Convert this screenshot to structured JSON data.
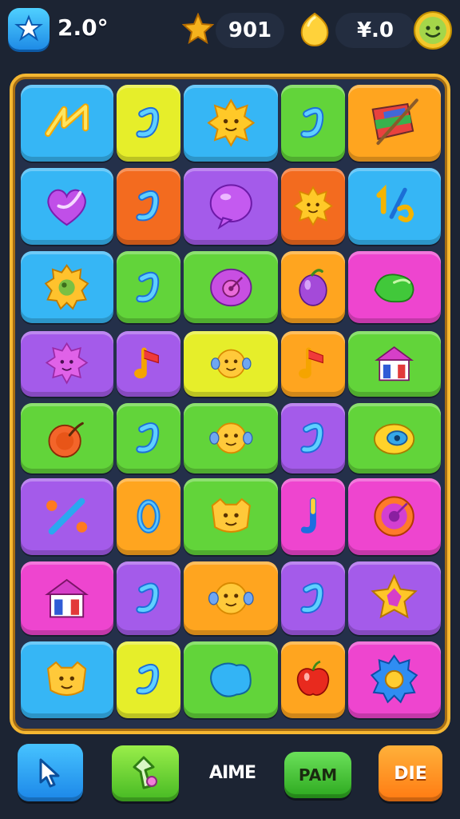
{
  "hud": {
    "level_value": "2.0°",
    "score_value": "901",
    "coins_value": "¥.0"
  },
  "bottom_bar": {
    "cursor_button": "cursor-icon",
    "hammer_button": "hammer-icon",
    "aime_label": "AIME",
    "pam_label": "PAM",
    "die_label": "DIE"
  },
  "board": {
    "rows": 8,
    "cols": 5,
    "colors": {
      "blue": "#36b6f5",
      "yellow": "#e6ee2a",
      "green": "#62d43a",
      "orange": "#ffa51f",
      "red": "#f36b1f",
      "purple": "#a45bea",
      "pink": "#ee45cf"
    },
    "tiles": [
      {
        "color": "blue",
        "icon": "zigzag"
      },
      {
        "color": "yellow",
        "icon": "swirl"
      },
      {
        "color": "blue",
        "icon": "sun-face"
      },
      {
        "color": "green",
        "icon": "swirl"
      },
      {
        "color": "orange",
        "icon": "flag"
      },
      {
        "color": "blue",
        "icon": "heart"
      },
      {
        "color": "red",
        "icon": "swirl"
      },
      {
        "color": "purple",
        "icon": "bubble"
      },
      {
        "color": "red",
        "icon": "sun-face"
      },
      {
        "color": "blue",
        "icon": "fraction"
      },
      {
        "color": "blue",
        "icon": "gear"
      },
      {
        "color": "green",
        "icon": "swirl"
      },
      {
        "color": "green",
        "icon": "heart-target"
      },
      {
        "color": "orange",
        "icon": "plum"
      },
      {
        "color": "pink",
        "icon": "leaf"
      },
      {
        "color": "purple",
        "icon": "spiky-face"
      },
      {
        "color": "purple",
        "icon": "music-note"
      },
      {
        "color": "yellow",
        "icon": "smiley-face"
      },
      {
        "color": "orange",
        "icon": "music-note"
      },
      {
        "color": "green",
        "icon": "house"
      },
      {
        "color": "green",
        "icon": "bomb"
      },
      {
        "color": "green",
        "icon": "swirl"
      },
      {
        "color": "green",
        "icon": "smiley-face"
      },
      {
        "color": "purple",
        "icon": "swirl"
      },
      {
        "color": "green",
        "icon": "eye"
      },
      {
        "color": "purple",
        "icon": "slash-flowers"
      },
      {
        "color": "orange",
        "icon": "ring"
      },
      {
        "color": "green",
        "icon": "cat-face"
      },
      {
        "color": "pink",
        "icon": "hook"
      },
      {
        "color": "pink",
        "icon": "target"
      },
      {
        "color": "pink",
        "icon": "house"
      },
      {
        "color": "purple",
        "icon": "swirl"
      },
      {
        "color": "orange",
        "icon": "smiley-face"
      },
      {
        "color": "purple",
        "icon": "swirl"
      },
      {
        "color": "purple",
        "icon": "star-gem"
      },
      {
        "color": "blue",
        "icon": "cat-face"
      },
      {
        "color": "yellow",
        "icon": "swirl"
      },
      {
        "color": "green",
        "icon": "blob"
      },
      {
        "color": "orange",
        "icon": "apple"
      },
      {
        "color": "pink",
        "icon": "gear-blue"
      }
    ]
  }
}
